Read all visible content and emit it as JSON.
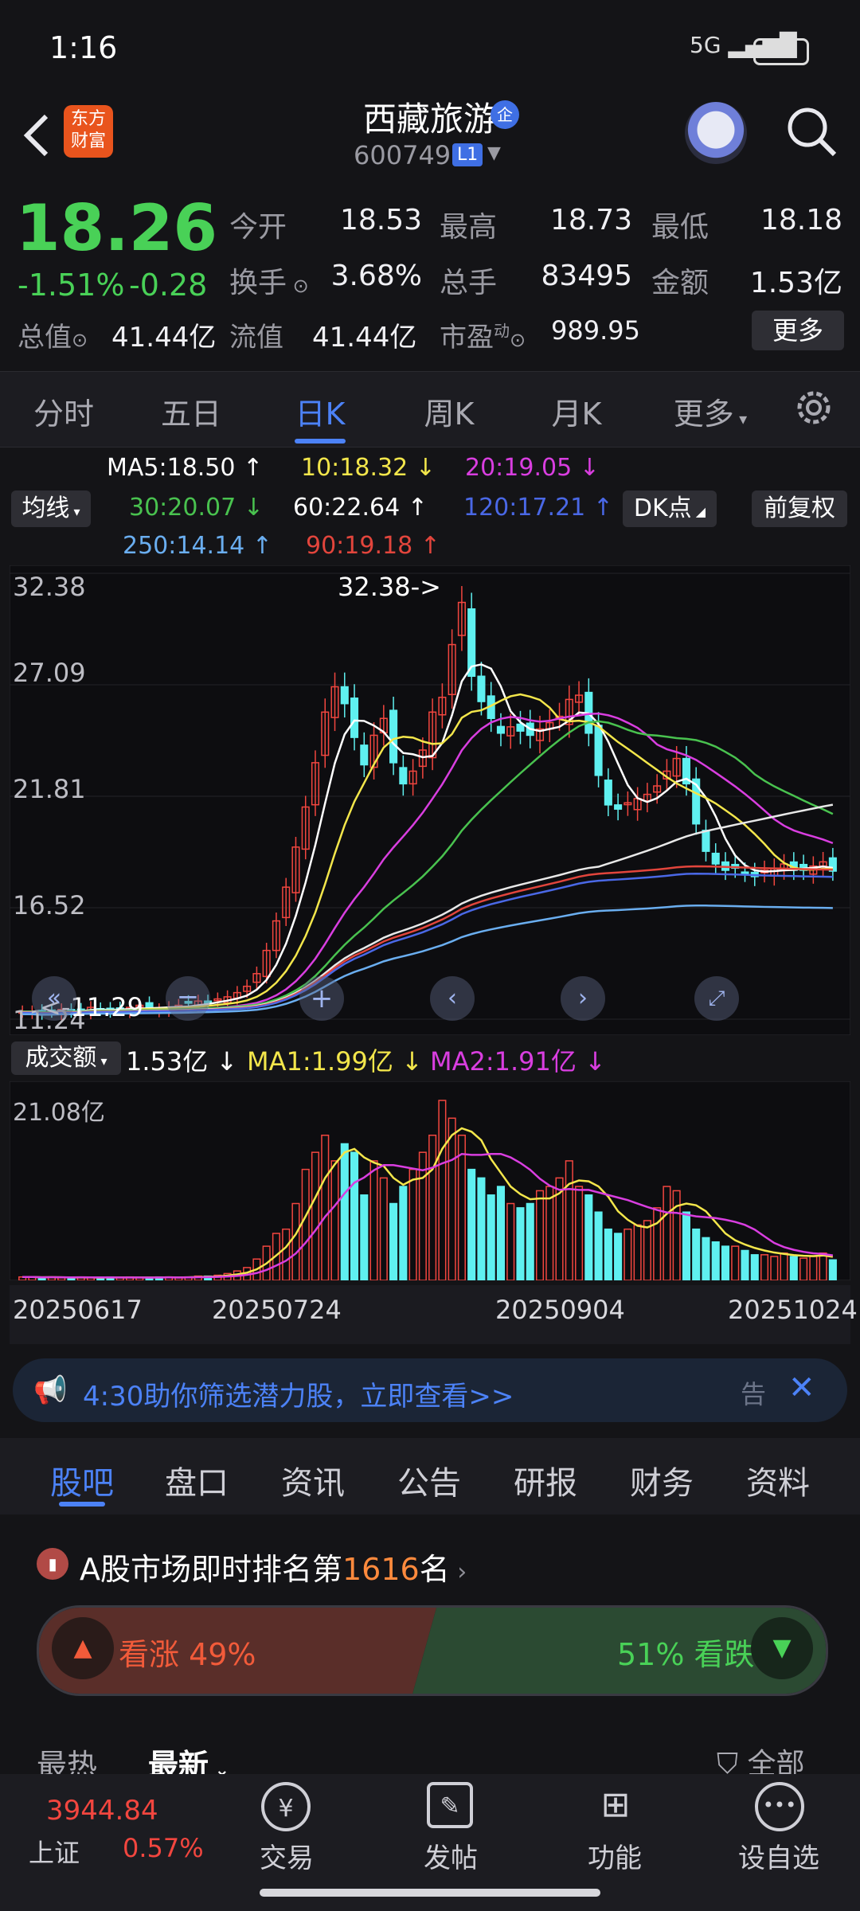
{
  "status_bar": {
    "time": "1:16",
    "signal": "5G",
    "battery": "87"
  },
  "header": {
    "logo_text": "东方财富",
    "stock_name": "西藏旅游",
    "badge": "企",
    "code": "600749",
    "level": "L1"
  },
  "quote": {
    "price": "18.26",
    "change_pct": "-1.51%",
    "change": "-0.28",
    "rows": [
      [
        {
          "label": "今开",
          "value": "18.53",
          "color": "#49d157"
        },
        {
          "label": "最高",
          "value": "18.73",
          "color": "#f2463f"
        },
        {
          "label": "最低",
          "value": "18.18",
          "color": "#49d157"
        }
      ],
      [
        {
          "label": "换手",
          "value": "3.68%",
          "color": "#f0f0f4"
        },
        {
          "label": "总手",
          "value": "83495",
          "color": "#f0f0f4"
        },
        {
          "label": "金额",
          "value": "1.53亿",
          "color": "#f0f0f4"
        }
      ]
    ],
    "total_cap_label": "总值",
    "total_cap": "41.44亿",
    "float_cap_label": "流值",
    "float_cap": "41.44亿",
    "pe_label": "市盈",
    "pe_sup": "动",
    "pe": "989.95",
    "more": "更多"
  },
  "period_tabs": [
    "分时",
    "五日",
    "日K",
    "周K",
    "月K",
    "更多"
  ],
  "active_period": 2,
  "ma_legend": {
    "ma5": "MA5:18.50",
    "ma10": "10:18.32",
    "ma20": "20:19.05",
    "ma30": "30:20.07",
    "ma60": "60:22.64",
    "ma120": "120:17.21",
    "ma250": "250:14.14",
    "ma90": "90:19.18",
    "indicator": "均线",
    "dk": "DK点",
    "adjust": "前复权"
  },
  "chart_data": {
    "type": "candlestick",
    "y_ticks": [
      "32.38",
      "27.09",
      "21.81",
      "16.52",
      "11.24"
    ],
    "ylim": [
      11.24,
      32.38
    ],
    "high_label": "32.38->",
    "low_label": "<-11.29",
    "x_ticks": [
      "20250617",
      "20250724",
      "20250904",
      "20251024"
    ],
    "close_series": [
      11.6,
      11.6,
      11.5,
      11.6,
      11.7,
      11.6,
      11.7,
      11.8,
      11.7,
      11.6,
      11.7,
      11.8,
      11.9,
      11.8,
      11.7,
      11.8,
      11.9,
      12.0,
      12.1,
      12.0,
      12.2,
      12.3,
      12.5,
      12.8,
      13.4,
      14.5,
      15.9,
      17.5,
      19.4,
      21.3,
      23.4,
      25.8,
      27.0,
      26.2,
      24.6,
      23.3,
      24.7,
      25.5,
      23.4,
      22.4,
      23.0,
      24.0,
      25.8,
      26.5,
      29.0,
      31.0,
      27.5,
      26.3,
      25.5,
      24.8,
      25.1,
      24.9,
      24.7,
      25.0,
      25.3,
      25.6,
      26.4,
      26.6,
      24.8,
      22.8,
      21.4,
      21.2,
      21.5,
      21.7,
      21.9,
      22.3,
      23.0,
      23.6,
      22.4,
      20.5,
      19.2,
      18.6,
      18.3,
      18.4,
      18.2,
      18.0,
      18.3,
      18.4,
      18.6,
      18.3,
      18.3,
      18.5,
      18.7,
      18.26
    ],
    "ma_values": {
      "MA5": "18.50",
      "MA10": "18.32",
      "MA20": "19.05",
      "MA30": "20.07",
      "MA60": "22.64",
      "MA90": "19.18",
      "MA120": "17.21",
      "MA250": "14.14"
    }
  },
  "volume": {
    "label": "成交额",
    "value": "1.53亿",
    "ma1": "MA1:1.99亿",
    "ma2": "MA2:1.91亿",
    "y_top": "21.08亿",
    "bars": [
      0.4,
      0.4,
      0.3,
      0.4,
      0.3,
      0.3,
      0.4,
      0.3,
      0.3,
      0.4,
      0.3,
      0.4,
      0.3,
      0.3,
      0.4,
      0.4,
      0.3,
      0.4,
      0.5,
      0.5,
      0.6,
      0.8,
      1.1,
      1.5,
      2.5,
      4.0,
      5.5,
      6.0,
      9.0,
      13.0,
      15.0,
      17.0,
      14.0,
      16.0,
      15.0,
      10.0,
      14.0,
      12.0,
      9.0,
      11.0,
      13.0,
      15.0,
      17.0,
      21.08,
      19.0,
      17.0,
      13.0,
      12.0,
      10.0,
      11.0,
      9.0,
      8.5,
      9.0,
      10.5,
      11.0,
      12.0,
      14.0,
      11.0,
      10.0,
      8.0,
      6.0,
      5.5,
      6.0,
      6.5,
      7.0,
      8.5,
      11.0,
      10.5,
      8.0,
      6.0,
      5.0,
      4.5,
      4.0,
      4.0,
      3.5,
      3.0,
      3.0,
      2.8,
      3.2,
      2.8,
      2.6,
      2.8,
      3.2,
      2.4
    ]
  },
  "banner": {
    "text": "4:30助你筛选潜力股，立即查看>>",
    "tag": "告"
  },
  "sub_tabs": [
    "股吧",
    "盘口",
    "资讯",
    "公告",
    "研报",
    "财务",
    "资料"
  ],
  "ranking": {
    "prefix": "A股市场即时排名第",
    "number": "1616",
    "suffix": "名"
  },
  "vote": {
    "up_label": "看涨 49%",
    "down_label": "51% 看跌",
    "up_pct": 49
  },
  "feed": {
    "hot": "最热",
    "latest": "最新",
    "filter": "全部"
  },
  "bottom": {
    "index_value": "3944.84",
    "index_name": "上证",
    "index_pct": "0.57%",
    "buttons": [
      "交易",
      "发帖",
      "功能",
      "设自选"
    ]
  }
}
